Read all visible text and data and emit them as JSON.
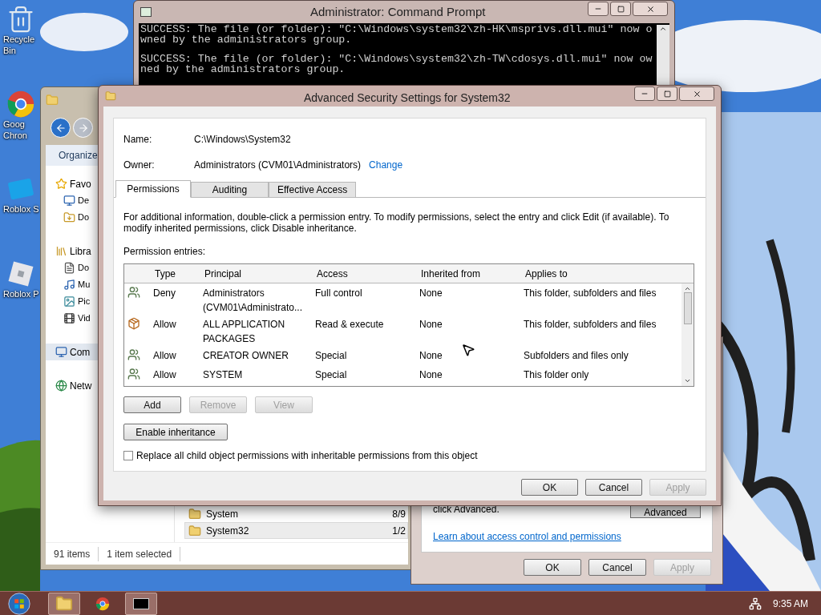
{
  "desktop": {
    "icons": [
      {
        "label": "Recycle Bin",
        "kind": "recycle"
      },
      {
        "label": "Goog Chron",
        "kind": "chrome"
      },
      {
        "label": "Roblox S",
        "kind": "roblox-studio"
      },
      {
        "label": "Roblox P",
        "kind": "roblox-player"
      }
    ]
  },
  "command_prompt": {
    "title": "Administrator: Command Prompt",
    "paragraphs": [
      [
        "SUCCESS: The file (or folder): \"C:\\Windows\\system32\\zh-HK\\msprivs.dll.mui\" now o",
        "wned by the administrators group."
      ],
      [
        "SUCCESS: The file (or folder): \"C:\\Windows\\system32\\zh-TW\\cdosys.dll.mui\" now ow",
        "ned by the administrators group."
      ]
    ]
  },
  "explorer": {
    "toolbar": [
      "Organize"
    ],
    "navigation": [
      {
        "label": "Favo",
        "kind": "star",
        "selected": false,
        "children": [
          {
            "label": "De",
            "kind": "desktop",
            "selected": false
          },
          {
            "label": "Do",
            "kind": "downloads",
            "selected": false
          }
        ]
      },
      {
        "label": "Libra",
        "kind": "library",
        "selected": false,
        "children": [
          {
            "label": "Do",
            "kind": "document",
            "selected": false
          },
          {
            "label": "Mu",
            "kind": "music",
            "selected": false
          },
          {
            "label": "Pic",
            "kind": "pictures",
            "selected": false
          },
          {
            "label": "Vid",
            "kind": "video",
            "selected": false
          }
        ]
      },
      {
        "label": "Com",
        "kind": "computer",
        "selected": true
      },
      {
        "label": "Netw",
        "kind": "network",
        "selected": false
      }
    ],
    "files": [
      {
        "name": "System",
        "date": "8/9",
        "selected": false
      },
      {
        "name": "System32",
        "date": "1/2",
        "selected": true
      }
    ],
    "status_bar": [
      "91 items",
      "1 item selected"
    ]
  },
  "properties_dialog": {
    "note": "click Advanced.",
    "advanced_button": "Advanced",
    "link": "Learn about access control and permissions",
    "buttons": [
      {
        "label": "OK",
        "disabled": false
      },
      {
        "label": "Cancel",
        "disabled": false
      },
      {
        "label": "Apply",
        "disabled": true
      }
    ]
  },
  "security_dialog": {
    "title": "Advanced Security Settings for System32",
    "name_label": "Name:",
    "name": "C:\\Windows\\System32",
    "owner_label": "Owner:",
    "owner": "Administrators (CVM01\\Administrators)",
    "change_link": "Change",
    "tabs": [
      {
        "label": "Permissions",
        "selected": true
      },
      {
        "label": "Auditing",
        "selected": false
      },
      {
        "label": "Effective Access",
        "selected": false
      }
    ],
    "description": "For additional information, double-click a permission entry. To modify permissions, select the entry and click Edit (if available). To modify inherited permissions, click Disable inheritance.",
    "entries_label": "Permission entries:",
    "table": {
      "columns": [
        "Type",
        "Principal",
        "Access",
        "Inherited from",
        "Applies to"
      ],
      "rows": [
        {
          "kind": "group",
          "type": "Deny",
          "principal": "Administrators (CVM01\\Administrato...",
          "access": "Full control",
          "inherited_from": "None",
          "applies_to": "This folder, subfolders and files"
        },
        {
          "kind": "package",
          "type": "Allow",
          "principal": "ALL APPLICATION PACKAGES",
          "access": "Read & execute",
          "inherited_from": "None",
          "applies_to": "This folder, subfolders and files"
        },
        {
          "kind": "group",
          "type": "Allow",
          "principal": "CREATOR OWNER",
          "access": "Special",
          "inherited_from": "None",
          "applies_to": "Subfolders and files only"
        },
        {
          "kind": "group",
          "type": "Allow",
          "principal": "SYSTEM",
          "access": "Special",
          "inherited_from": "None",
          "applies_to": "This folder only"
        }
      ]
    },
    "entry_buttons": [
      {
        "label": "Add",
        "disabled": false
      },
      {
        "label": "Remove",
        "disabled": true
      },
      {
        "label": "View",
        "disabled": true
      }
    ],
    "inheritance_button": "Enable inheritance",
    "replace_checkbox": {
      "label": "Replace all child object permissions with inheritable permissions from this object",
      "checked": false
    },
    "buttons": [
      {
        "label": "OK",
        "disabled": false
      },
      {
        "label": "Cancel",
        "disabled": false
      },
      {
        "label": "Apply",
        "disabled": true
      }
    ]
  },
  "taskbar": {
    "items": [
      {
        "kind": "explorer",
        "running": true
      },
      {
        "kind": "chrome",
        "running": false
      },
      {
        "kind": "cmd",
        "running": true
      }
    ],
    "clock": "9:35 AM"
  }
}
